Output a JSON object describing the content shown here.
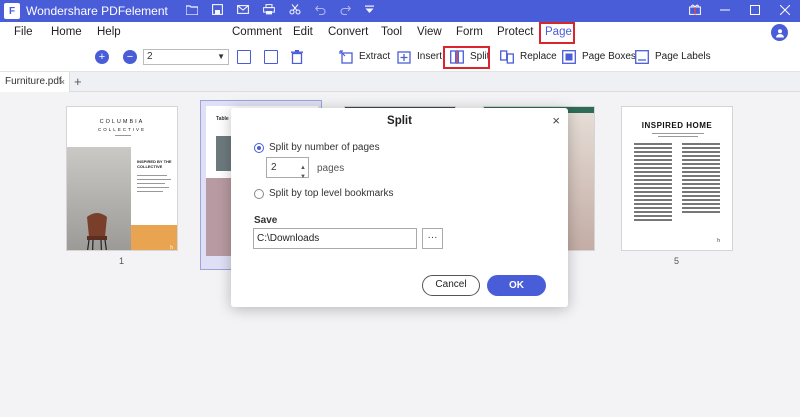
{
  "app": {
    "title": "Wondershare PDFelement",
    "logo_letter": "F",
    "quick_access": [
      "folder-icon",
      "save-icon",
      "mail-icon",
      "print-icon",
      "scissors-icon",
      "undo-icon",
      "redo-icon",
      "dropdown-icon"
    ],
    "window_controls": [
      "gift-icon",
      "minimize-icon",
      "maximize-icon",
      "close-icon"
    ],
    "accent_color": "#4a5dd8",
    "highlight_color": "#d9262c"
  },
  "menu": {
    "file": "File",
    "home": "Home",
    "help": "Help",
    "comment": "Comment",
    "edit": "Edit",
    "convert": "Convert",
    "tool": "Tool",
    "view": "View",
    "form": "Form",
    "protect": "Protect",
    "page": "Page"
  },
  "toolbar": {
    "zoom_in": "+",
    "zoom_out": "−",
    "page_value": "2",
    "extract": "Extract",
    "insert": "Insert",
    "split": "Split",
    "replace": "Replace",
    "page_boxes": "Page Boxes",
    "page_labels": "Page Labels"
  },
  "tabs": {
    "document": "Furniture.pdf",
    "close": "×",
    "add": "+"
  },
  "pages": {
    "p1_title": "COLUMBIA",
    "p1_subtitle": "COLLECTIVE",
    "p1_heading": "INSPIRED BY THE COLLECTIVE",
    "p1_page_mark": "h",
    "p1_number": "1",
    "p2_caption": "Table",
    "p5_title": "INSPIRED HOME",
    "p5_number": "5"
  },
  "dialog": {
    "title": "Split",
    "close": "×",
    "option_pages": "Split by number of pages",
    "pages_value": "2",
    "pages_unit": "pages",
    "option_bookmarks": "Split by top level bookmarks",
    "save_label": "Save",
    "save_path": "C:\\Downloads",
    "browse": "···",
    "cancel": "Cancel",
    "ok": "OK"
  }
}
